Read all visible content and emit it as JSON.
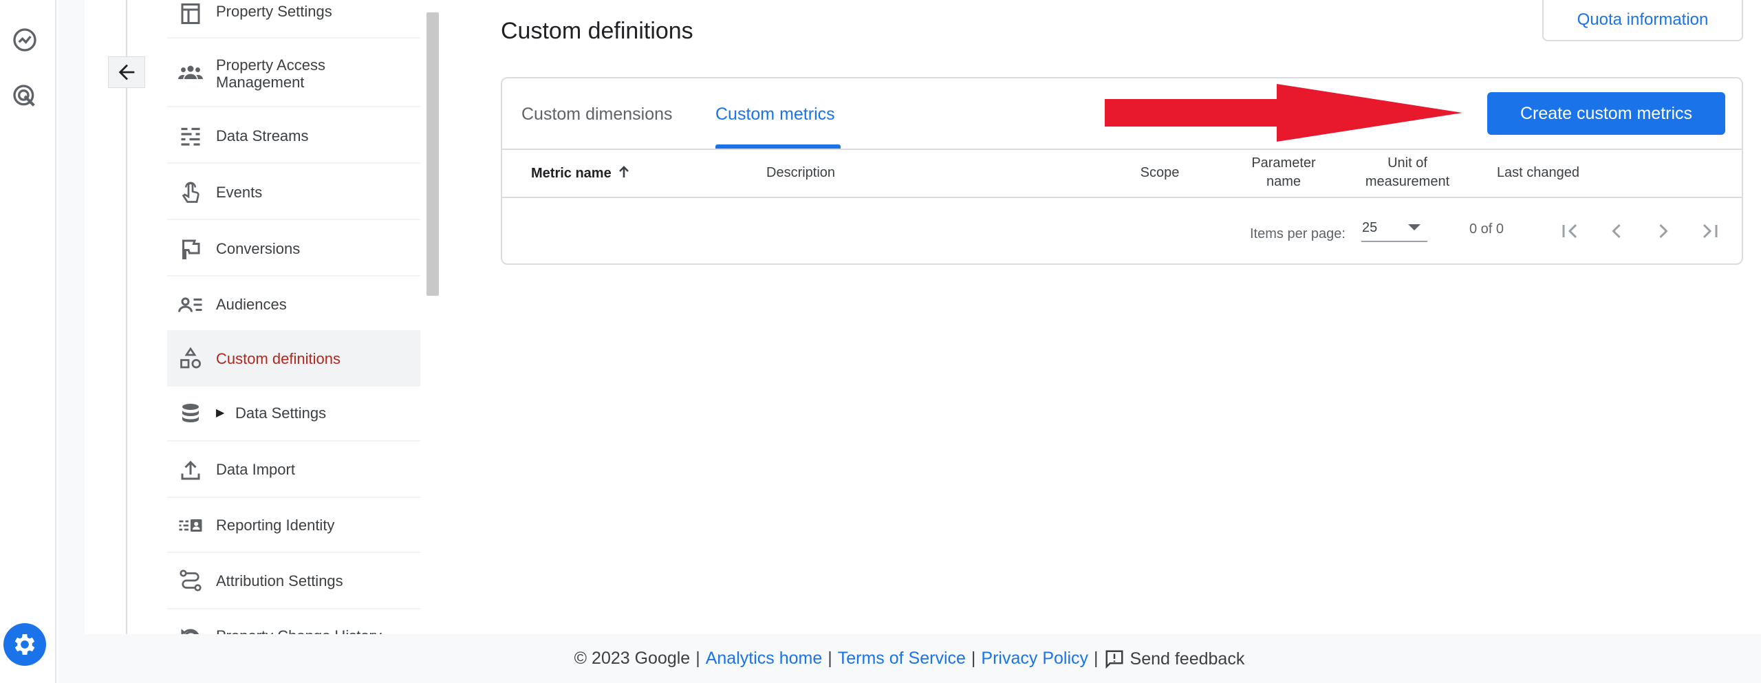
{
  "rail": {
    "icons": [
      "analytics-reports-icon",
      "advertising-target-icon",
      "admin-settings-icon"
    ]
  },
  "nav": {
    "items": [
      {
        "label": "Property Settings",
        "icon": "property-settings-icon"
      },
      {
        "label": "Property Access Management",
        "icon": "people-icon"
      },
      {
        "label": "Data Streams",
        "icon": "data-streams-icon"
      },
      {
        "label": "Events",
        "icon": "touch-events-icon"
      },
      {
        "label": "Conversions",
        "icon": "flag-icon"
      },
      {
        "label": "Audiences",
        "icon": "audiences-icon"
      },
      {
        "label": "Custom definitions",
        "icon": "shapes-icon",
        "active": true
      },
      {
        "label": "Data Settings",
        "icon": "database-icon",
        "expandable": true
      },
      {
        "label": "Data Import",
        "icon": "upload-icon"
      },
      {
        "label": "Reporting Identity",
        "icon": "reporting-identity-icon"
      },
      {
        "label": "Attribution Settings",
        "icon": "attribution-icon"
      },
      {
        "label": "Property Change History",
        "icon": "history-icon"
      }
    ]
  },
  "page": {
    "title": "Custom definitions",
    "quota_button": "Quota information"
  },
  "tabs": [
    {
      "label": "Custom dimensions",
      "active": false
    },
    {
      "label": "Custom metrics",
      "active": true
    }
  ],
  "create_button": "Create custom metrics",
  "table": {
    "columns": [
      {
        "label": "Metric name",
        "sorted": "ascending"
      },
      {
        "label": "Description"
      },
      {
        "label": "Scope"
      },
      {
        "label": "Parameter name"
      },
      {
        "label": "Unit of measurement"
      },
      {
        "label": "Last changed"
      }
    ],
    "rows": []
  },
  "pagination": {
    "items_per_page_label": "Items per page:",
    "items_per_page": "25",
    "range": "0 of 0"
  },
  "footer": {
    "copyright": "© 2023 Google",
    "links": [
      "Analytics home",
      "Terms of Service",
      "Privacy Policy"
    ],
    "feedback": "Send feedback"
  },
  "colors": {
    "accent": "#1a73e8",
    "active_nav_text": "#b3261e",
    "annotation_arrow": "#e8192c"
  }
}
